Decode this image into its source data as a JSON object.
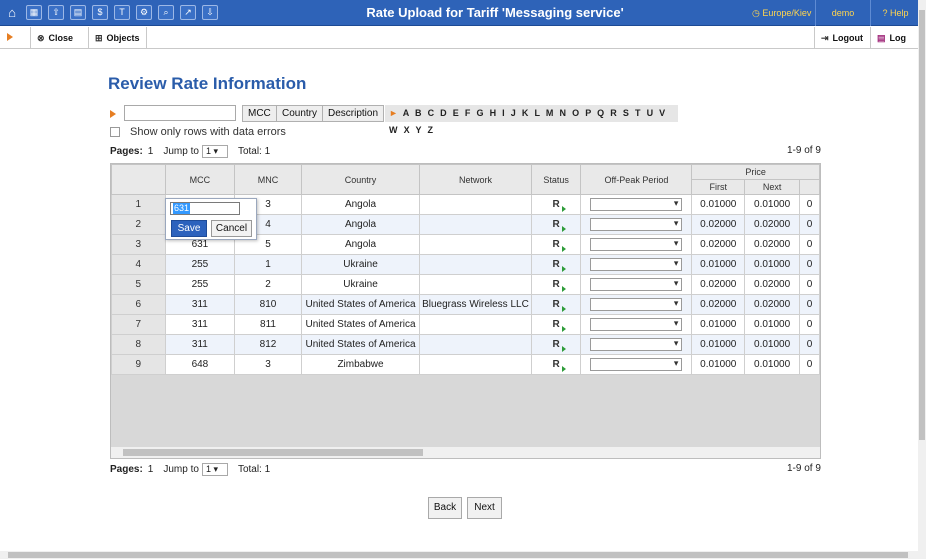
{
  "topbar": {
    "title": "Rate Upload for Tariff 'Messaging service'",
    "timezone": "Europe/Kiev",
    "user": "demo",
    "help": "Help",
    "icons": [
      "home-icon",
      "grid-icon",
      "upload-icon",
      "table-icon",
      "currency-icon",
      "tariff-icon",
      "settings-icon",
      "search-icon",
      "chart-icon",
      "export-icon"
    ]
  },
  "subbar": {
    "close_label": "Close",
    "objects_label": "Objects",
    "logout_label": "Logout",
    "log_label": "Log"
  },
  "heading": "Review Rate Information",
  "filter": {
    "input_value": "",
    "buttons": [
      "MCC",
      "Country",
      "Description"
    ],
    "letters": "A B C D E F G H I J K L M N O P Q R S T U V W X Y Z"
  },
  "error_filter_label": "Show only rows with data errors",
  "pager": {
    "pages_label": "Pages:",
    "page": "1",
    "jump_label": "Jump to",
    "jump_value": "1",
    "total_label": "Total: 1",
    "range": "1-9 of 9"
  },
  "columns": {
    "mcc": "MCC",
    "mnc": "MNC",
    "country": "Country",
    "network": "Network",
    "status": "Status",
    "offpeak": "Off-Peak Period",
    "price": "Price",
    "first": "First",
    "next": "Next"
  },
  "rows": [
    {
      "n": "1",
      "mcc": "631",
      "mnc": "3",
      "country": "Angola",
      "network": "",
      "first": "0.01000",
      "next": "0.01000",
      "extra": "0"
    },
    {
      "n": "2",
      "mcc": "631",
      "mnc": "4",
      "country": "Angola",
      "network": "",
      "first": "0.02000",
      "next": "0.02000",
      "extra": "0"
    },
    {
      "n": "3",
      "mcc": "631",
      "mnc": "5",
      "country": "Angola",
      "network": "",
      "first": "0.02000",
      "next": "0.02000",
      "extra": "0"
    },
    {
      "n": "4",
      "mcc": "255",
      "mnc": "1",
      "country": "Ukraine",
      "network": "",
      "first": "0.01000",
      "next": "0.01000",
      "extra": "0"
    },
    {
      "n": "5",
      "mcc": "255",
      "mnc": "2",
      "country": "Ukraine",
      "network": "",
      "first": "0.02000",
      "next": "0.02000",
      "extra": "0"
    },
    {
      "n": "6",
      "mcc": "311",
      "mnc": "810",
      "country": "United States of America",
      "network": "Bluegrass Wireless LLC",
      "first": "0.02000",
      "next": "0.02000",
      "extra": "0"
    },
    {
      "n": "7",
      "mcc": "311",
      "mnc": "811",
      "country": "United States of America",
      "network": "",
      "first": "0.01000",
      "next": "0.01000",
      "extra": "0"
    },
    {
      "n": "8",
      "mcc": "311",
      "mnc": "812",
      "country": "United States of America",
      "network": "",
      "first": "0.01000",
      "next": "0.01000",
      "extra": "0"
    },
    {
      "n": "9",
      "mcc": "648",
      "mnc": "3",
      "country": "Zimbabwe",
      "network": "",
      "first": "0.01000",
      "next": "0.01000",
      "extra": "0"
    }
  ],
  "editor": {
    "value": "631",
    "save_label": "Save",
    "cancel_label": "Cancel"
  },
  "footer": {
    "back_label": "Back",
    "next_label": "Next"
  }
}
